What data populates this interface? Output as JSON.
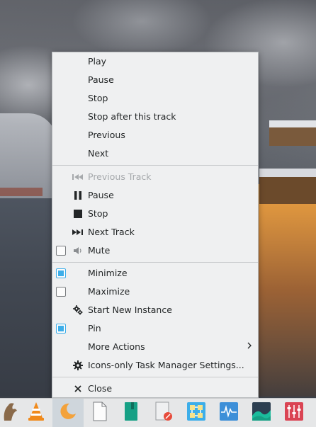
{
  "menu": {
    "media_section": {
      "play": "Play",
      "pause": "Pause",
      "stop": "Stop",
      "stop_after": "Stop after this track",
      "previous": "Previous",
      "next": "Next"
    },
    "player_controls": {
      "previous_track": "Previous Track",
      "pause": "Pause",
      "stop": "Stop",
      "next_track": "Next Track",
      "mute": "Mute",
      "mute_checked": false
    },
    "window_section": {
      "minimize": "Minimize",
      "minimize_checked": true,
      "maximize": "Maximize",
      "maximize_checked": false,
      "start_new_instance": "Start New Instance",
      "pin": "Pin",
      "pin_checked": true,
      "more_actions": "More Actions",
      "settings": "Icons-only Task Manager Settings..."
    },
    "close": "Close"
  },
  "taskbar": {
    "items": [
      {
        "icon": "app-launcher-icon"
      },
      {
        "icon": "vlc-icon"
      },
      {
        "icon": "cantata-icon",
        "active": true
      },
      {
        "icon": "blank-document-icon"
      },
      {
        "icon": "notebook-icon"
      },
      {
        "icon": "text-editor-icon"
      },
      {
        "icon": "network-icon"
      },
      {
        "icon": "system-monitor-icon"
      },
      {
        "icon": "graph-icon"
      },
      {
        "icon": "audio-mixer-icon"
      }
    ]
  },
  "colors": {
    "accent": "#3daee9",
    "menu_bg": "#eff0f1",
    "text": "#232627",
    "disabled_text": "#a6a9ac"
  }
}
